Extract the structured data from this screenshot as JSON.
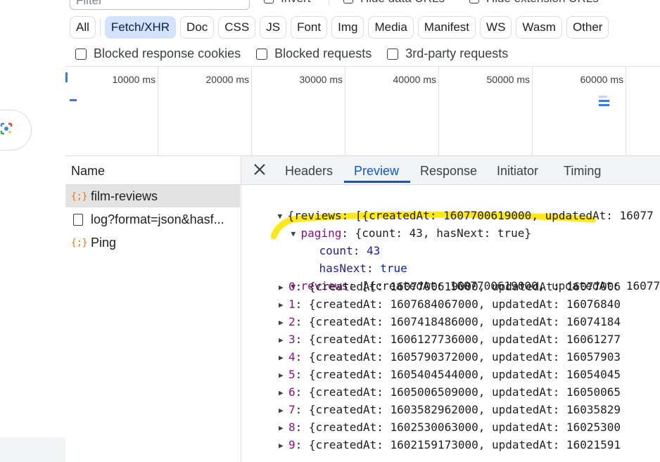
{
  "filter": {
    "placeholder": "Filter"
  },
  "top_checkboxes": [
    "Invert",
    "Hide data URLs",
    "Hide extension URLs"
  ],
  "type_chips": [
    "All",
    "Fetch/XHR",
    "Doc",
    "CSS",
    "JS",
    "Font",
    "Img",
    "Media",
    "Manifest",
    "WS",
    "Wasm",
    "Other"
  ],
  "active_chip": "Fetch/XHR",
  "checkbox_row": [
    "Blocked response cookies",
    "Blocked requests",
    "3rd-party requests"
  ],
  "timeline": {
    "ticks": [
      "10000 ms",
      "20000 ms",
      "30000 ms",
      "40000 ms",
      "50000 ms",
      "60000 ms"
    ]
  },
  "requests": {
    "header": "Name",
    "rows": [
      {
        "name": "film-reviews",
        "icon": "fetch-xhr-icon",
        "selected": true
      },
      {
        "name": "log?format=json&hasf...",
        "icon": "document-icon",
        "selected": false
      },
      {
        "name": "Ping",
        "icon": "fetch-xhr-icon",
        "selected": false
      }
    ]
  },
  "details": {
    "tabs": [
      "Headers",
      "Preview",
      "Response",
      "Initiator",
      "Timing"
    ],
    "active_tab": "Preview"
  },
  "preview": {
    "root_prefix": "{reviews: [{createdAt: 1607700619000, updatedAt: 16077",
    "paging_key": "paging",
    "paging_summary": "{count: 43, hasNext: true}",
    "count_key": "count",
    "count_value": "43",
    "hasnext_key": "hasNext",
    "hasnext_value": "true",
    "reviews_key": "reviews",
    "reviews_summary": "[{createdAt: 1607700619000, updatedAt: 16077",
    "items": [
      {
        "index": "0",
        "createdAt": "1607700619000",
        "updatedAt": "16077006"
      },
      {
        "index": "1",
        "createdAt": "1607684067000",
        "updatedAt": "16076840"
      },
      {
        "index": "2",
        "createdAt": "1607418486000",
        "updatedAt": "16074184"
      },
      {
        "index": "3",
        "createdAt": "1606127736000",
        "updatedAt": "16061277"
      },
      {
        "index": "4",
        "createdAt": "1605790372000",
        "updatedAt": "16057903"
      },
      {
        "index": "5",
        "createdAt": "1605404544000",
        "updatedAt": "16054045"
      },
      {
        "index": "6",
        "createdAt": "1605006509000",
        "updatedAt": "16050065"
      },
      {
        "index": "7",
        "createdAt": "1603582962000",
        "updatedAt": "16035829"
      },
      {
        "index": "8",
        "createdAt": "1602530063000",
        "updatedAt": "16025300"
      },
      {
        "index": "9",
        "createdAt": "1602159173000",
        "updatedAt": "16021591"
      }
    ]
  },
  "colors": {
    "active_chip_bg": "#d3e3fd",
    "active_tab": "#0b57d0",
    "highlight_marker": "#ffe600",
    "json_key": "#881280",
    "json_value": "#1a1aa6"
  }
}
